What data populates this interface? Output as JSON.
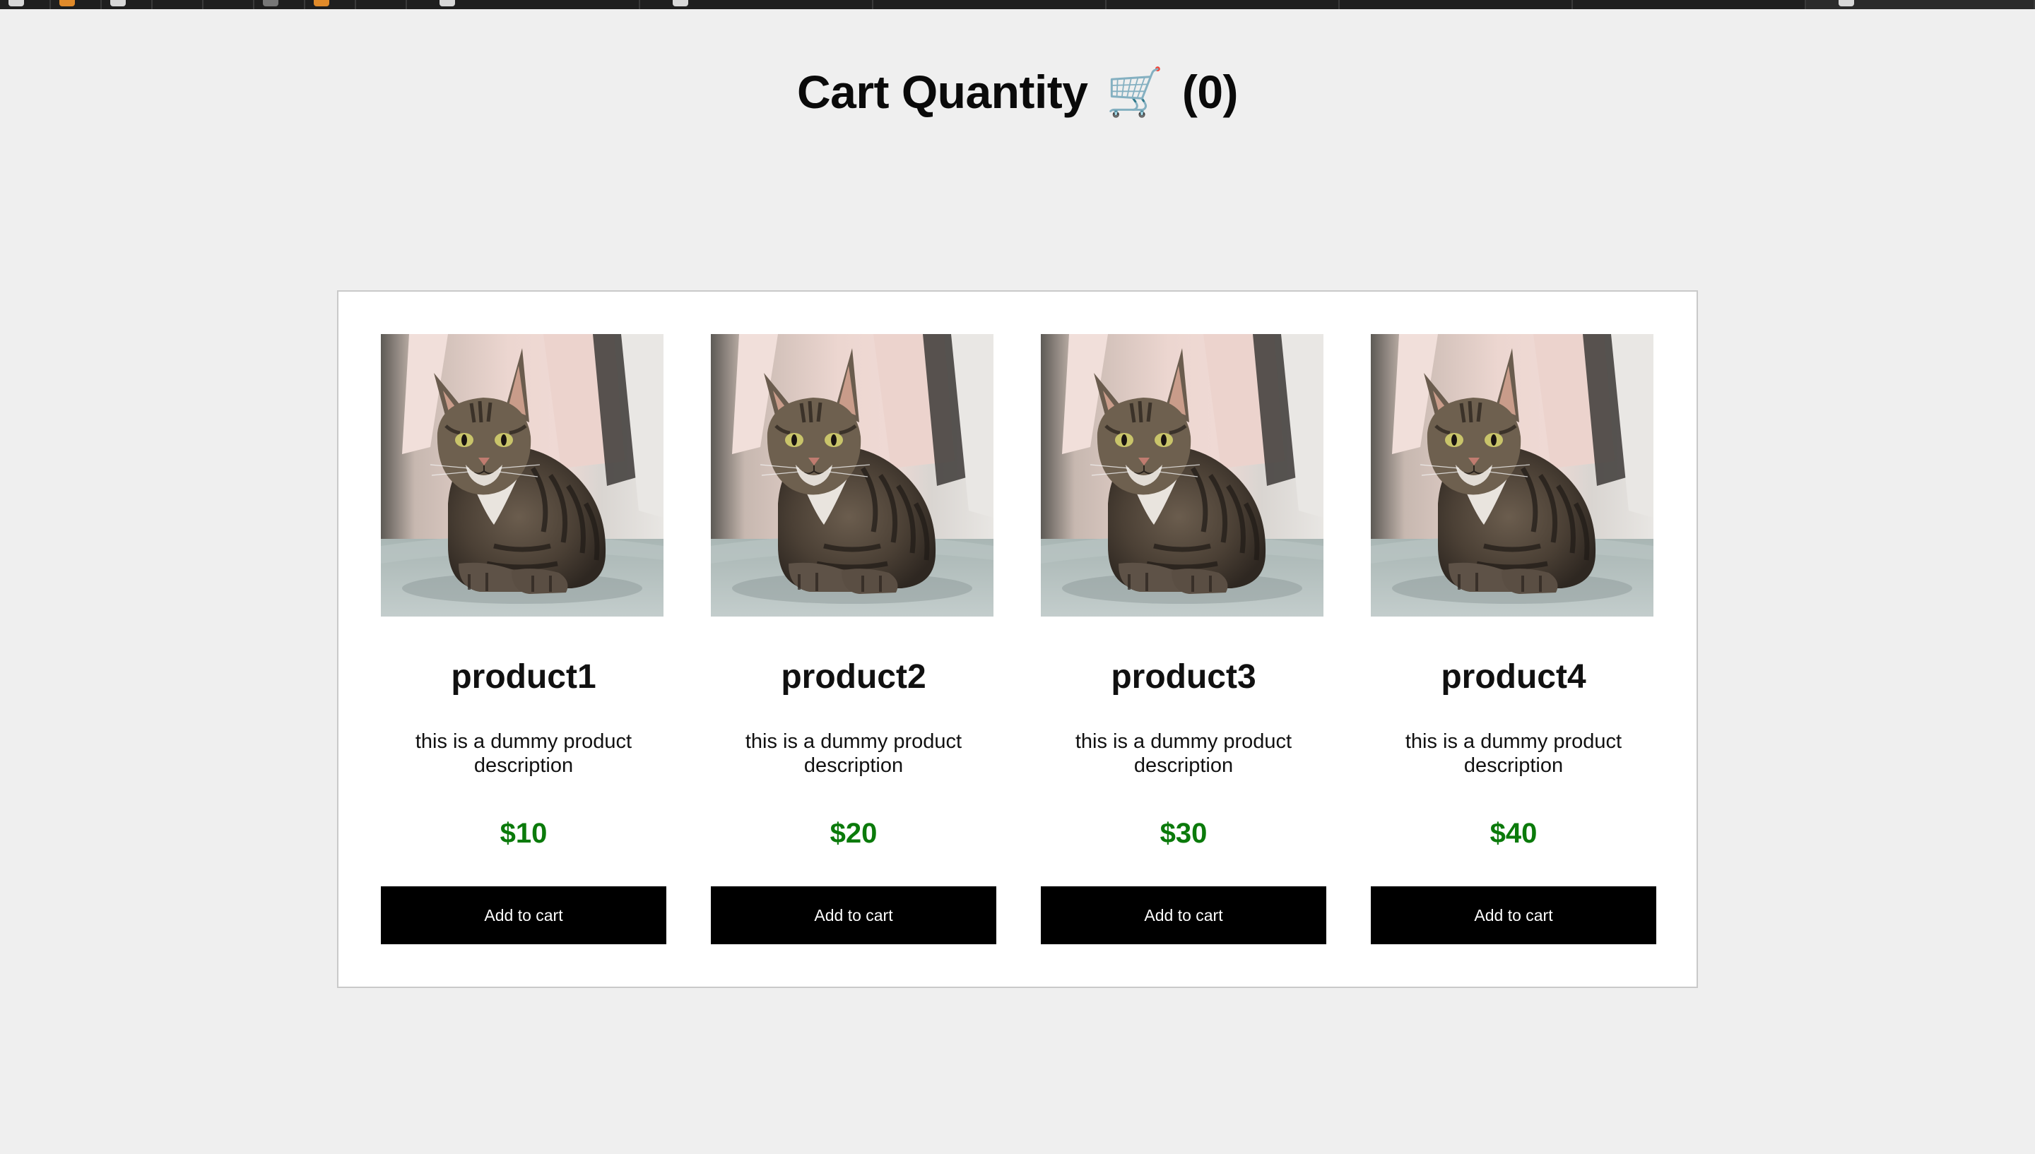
{
  "page": {
    "title_text": "Cart Quantity",
    "cart_icon": "🛒",
    "cart_count": "(0)"
  },
  "products": [
    {
      "name": "product1",
      "description": "this is a dummy product description",
      "price": "$10",
      "button_label": "Add to cart",
      "image_icon": "cat-photo"
    },
    {
      "name": "product2",
      "description": "this is a dummy product description",
      "price": "$20",
      "button_label": "Add to cart",
      "image_icon": "cat-photo"
    },
    {
      "name": "product3",
      "description": "this is a dummy product description",
      "price": "$30",
      "button_label": "Add to cart",
      "image_icon": "cat-photo"
    },
    {
      "name": "product4",
      "description": "this is a dummy product description",
      "price": "$40",
      "button_label": "Add to cart",
      "image_icon": "cat-photo"
    }
  ],
  "colors": {
    "background": "#efefef",
    "price": "#0b7a0b",
    "button": "#000000",
    "button_text": "#ffffff"
  }
}
